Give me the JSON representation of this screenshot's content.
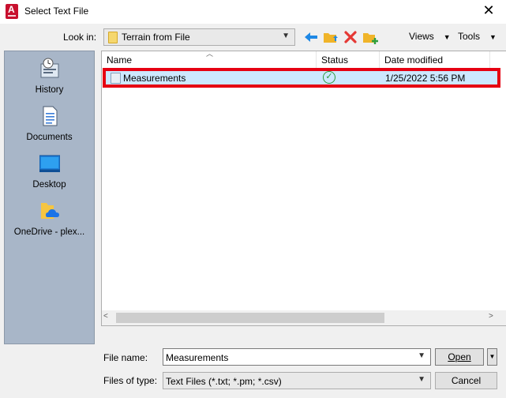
{
  "window": {
    "title": "Select Text File",
    "close_glyph": "✕"
  },
  "lookin": {
    "label": "Look in:",
    "value": "Terrain from File"
  },
  "toolbar": {
    "views_label": "Views",
    "tools_label": "Tools"
  },
  "places": [
    {
      "label": "History",
      "icon": "history-icon"
    },
    {
      "label": "Documents",
      "icon": "documents-icon"
    },
    {
      "label": "Desktop",
      "icon": "desktop-icon"
    },
    {
      "label": "OneDrive - plex...",
      "icon": "onedrive-icon"
    }
  ],
  "filelist": {
    "columns": {
      "name": "Name",
      "status": "Status",
      "date": "Date modified"
    },
    "rows": [
      {
        "name": "Measurements",
        "status": "synced",
        "date": "1/25/2022 5:56 PM"
      }
    ]
  },
  "filename": {
    "label": "File name:",
    "value": "Measurements"
  },
  "filetype": {
    "label": "Files of type:",
    "value": "Text Files (*.txt; *.pm; *.csv)"
  },
  "buttons": {
    "open": "Open",
    "cancel": "Cancel"
  },
  "colors": {
    "selection_bg": "#cce8ff",
    "highlight_border": "#e60012",
    "places_bg": "#a8b6c8"
  }
}
